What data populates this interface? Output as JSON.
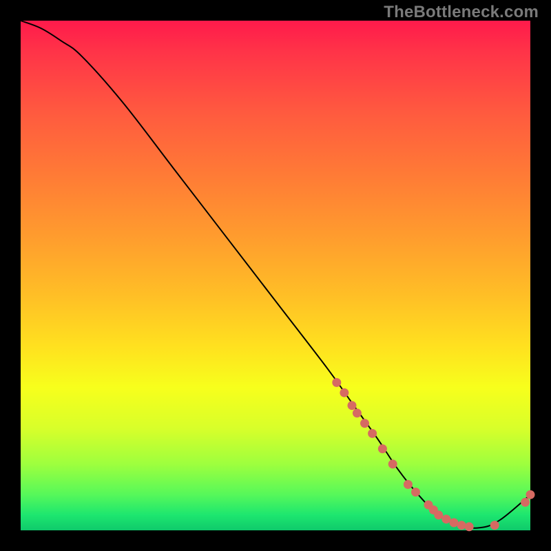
{
  "watermark": "TheBottleneck.com",
  "chart_data": {
    "type": "line",
    "title": "",
    "xlabel": "",
    "ylabel": "",
    "xlim": [
      0,
      100
    ],
    "ylim": [
      0,
      100
    ],
    "grid": false,
    "legend": false,
    "gradient_stops": [
      {
        "pos": 0.0,
        "color": "#ff1a4b"
      },
      {
        "pos": 0.18,
        "color": "#ff5a3f"
      },
      {
        "pos": 0.42,
        "color": "#ff9b2e"
      },
      {
        "pos": 0.64,
        "color": "#ffe11f"
      },
      {
        "pos": 0.8,
        "color": "#d8ff2a"
      },
      {
        "pos": 0.93,
        "color": "#56f85a"
      },
      {
        "pos": 1.0,
        "color": "#0fca6b"
      }
    ],
    "series": [
      {
        "name": "bottleneck-curve",
        "x": [
          0,
          4,
          8,
          12,
          20,
          30,
          40,
          50,
          60,
          65,
          70,
          74,
          78,
          82,
          86,
          90,
          94,
          100
        ],
        "y": [
          100,
          98.5,
          96,
          93,
          84,
          71,
          58,
          45,
          32,
          25,
          18,
          12,
          7,
          3,
          1,
          0.5,
          2,
          7
        ]
      }
    ],
    "markers": {
      "name": "highlighted-points",
      "color": "#d66a62",
      "x": [
        62,
        63.5,
        65,
        66,
        67.5,
        69,
        71,
        73,
        76,
        77.5,
        80,
        81,
        82,
        83.5,
        85,
        86.5,
        88,
        93,
        99,
        100
      ],
      "y": [
        29,
        27,
        24.5,
        23,
        21,
        19,
        16,
        13,
        9,
        7.5,
        5,
        4,
        3,
        2.2,
        1.5,
        1,
        0.7,
        1,
        5.5,
        7
      ]
    }
  }
}
